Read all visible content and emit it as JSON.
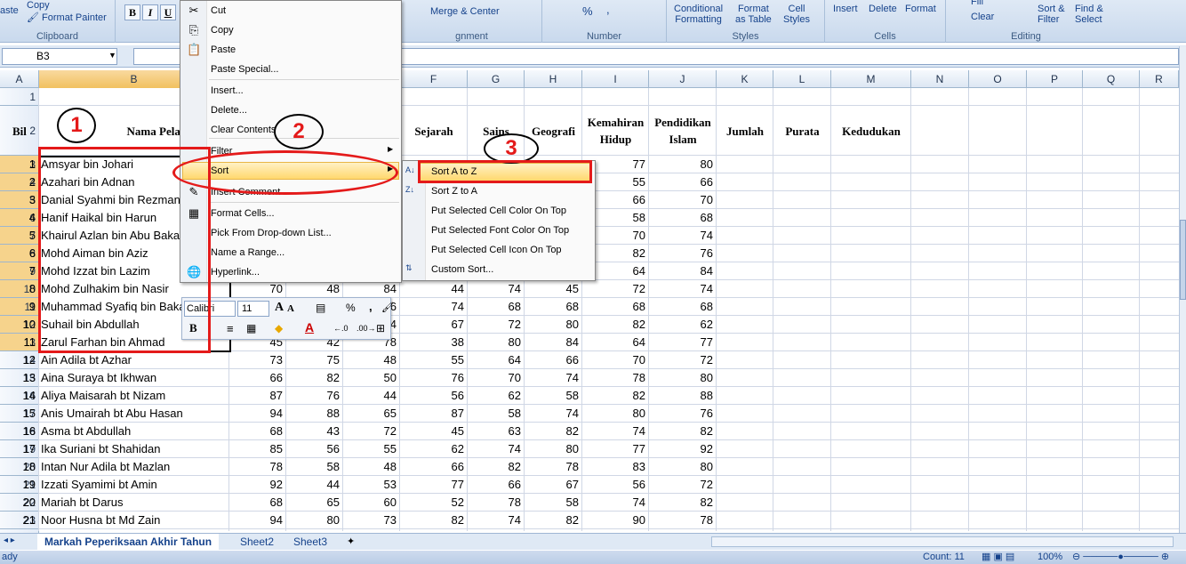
{
  "ribbon": {
    "clipboard": {
      "paste": "aste",
      "copy": "Copy",
      "format_painter": "Format Painter",
      "label": "Clipboard"
    },
    "font": {
      "bold": "B",
      "italic": "I",
      "underline": "U"
    },
    "alignment": {
      "merge": "Merge & Center",
      "label": "gnment"
    },
    "number": {
      "percent": "%",
      "comma": ",",
      "label": "Number"
    },
    "styles": {
      "conditional": "Conditional\nFormatting",
      "format_table": "Format\nas Table",
      "cell_styles": "Cell\nStyles",
      "label": "Styles"
    },
    "cells": {
      "insert": "Insert",
      "delete": "Delete",
      "format": "Format",
      "label": "Cells"
    },
    "editing": {
      "fill": "Fill",
      "clear": "Clear",
      "sort_filter": "Sort &\nFilter",
      "find_select": "Find &\nSelect",
      "label": "Editing"
    }
  },
  "formula_bar": {
    "name_box": "B3",
    "formula": ""
  },
  "columns": [
    "A",
    "B",
    "C",
    "D",
    "E",
    "F",
    "G",
    "H",
    "I",
    "J",
    "K",
    "L",
    "M",
    "N",
    "O",
    "P",
    "Q",
    "R"
  ],
  "headers": {
    "bil": "Bil",
    "nama": "Nama Pelajar",
    "bm": "k",
    "sejarah": "Sejarah",
    "sains": "Sains",
    "geografi": "Geografi",
    "kemahiran": "Kemahiran\nHidup",
    "pendidikan": "Pendidikan\nIslam",
    "jumlah": "Jumlah",
    "purata": "Purata",
    "kedudukan": "Kedudukan"
  },
  "rows": [
    {
      "bil": "1",
      "name": "Amsyar bin Johari",
      "c": "",
      "d": "",
      "e": "",
      "f": "",
      "g": "",
      "h": "",
      "i": "77",
      "j": "80"
    },
    {
      "bil": "2",
      "name": "Azahari bin Adnan",
      "c": "",
      "d": "",
      "e": "",
      "f": "",
      "g": "",
      "h": "",
      "i": "55",
      "j": "66"
    },
    {
      "bil": "3",
      "name": "Danial Syahmi bin Rezman",
      "c": "",
      "d": "",
      "e": "",
      "f": "",
      "g": "",
      "h": "",
      "i": "66",
      "j": "70"
    },
    {
      "bil": "4",
      "name": "Hanif Haikal bin Harun",
      "c": "",
      "d": "",
      "e": "",
      "f": "",
      "g": "",
      "h": "",
      "i": "58",
      "j": "68"
    },
    {
      "bil": "5",
      "name": "Khairul Azlan bin Abu Bakar",
      "c": "",
      "d": "",
      "e": "",
      "f": "",
      "g": "",
      "h": "",
      "i": "70",
      "j": "74"
    },
    {
      "bil": "6",
      "name": "Mohd Aiman bin Aziz",
      "c": "",
      "d": "",
      "e": "",
      "f": "",
      "g": "",
      "h": "",
      "i": "82",
      "j": "76"
    },
    {
      "bil": "7",
      "name": "Mohd Izzat bin Lazim",
      "c": "",
      "d": "",
      "e": "",
      "f": "",
      "g": "",
      "h": "",
      "i": "64",
      "j": "84"
    },
    {
      "bil": "8",
      "name": "Mohd Zulhakim bin Nasir",
      "c": "70",
      "d": "48",
      "e": "84",
      "f": "44",
      "g": "74",
      "h": "45",
      "i": "72",
      "j": "74"
    },
    {
      "bil": "9",
      "name": "Muhammad Syafiq bin Bakar",
      "c": "",
      "d": "",
      "e": "6",
      "f": "74",
      "g": "68",
      "h": "68",
      "i": "68",
      "j": "68"
    },
    {
      "bil": "10",
      "name": "Suhail bin Abdullah",
      "c": "",
      "d": "",
      "e": "4",
      "f": "67",
      "g": "72",
      "h": "80",
      "i": "82",
      "j": "62"
    },
    {
      "bil": "11",
      "name": "Zarul Farhan bin Ahmad",
      "c": "45",
      "d": "42",
      "e": "78",
      "f": "38",
      "g": "80",
      "h": "84",
      "i": "64",
      "j": "77"
    },
    {
      "bil": "12",
      "name": "Ain Adila bt Azhar",
      "c": "73",
      "d": "75",
      "e": "48",
      "f": "55",
      "g": "64",
      "h": "66",
      "i": "70",
      "j": "72"
    },
    {
      "bil": "13",
      "name": "Aina Suraya bt Ikhwan",
      "c": "66",
      "d": "82",
      "e": "50",
      "f": "76",
      "g": "70",
      "h": "74",
      "i": "78",
      "j": "80"
    },
    {
      "bil": "14",
      "name": "Aliya Maisarah bt Nizam",
      "c": "87",
      "d": "76",
      "e": "44",
      "f": "56",
      "g": "62",
      "h": "58",
      "i": "82",
      "j": "88"
    },
    {
      "bil": "15",
      "name": "Anis Umairah bt Abu Hasan",
      "c": "94",
      "d": "88",
      "e": "65",
      "f": "87",
      "g": "58",
      "h": "74",
      "i": "80",
      "j": "76"
    },
    {
      "bil": "16",
      "name": "Asma bt Abdullah",
      "c": "68",
      "d": "43",
      "e": "72",
      "f": "45",
      "g": "63",
      "h": "82",
      "i": "74",
      "j": "82"
    },
    {
      "bil": "17",
      "name": "Ika Suriani bt Shahidan",
      "c": "85",
      "d": "56",
      "e": "55",
      "f": "62",
      "g": "74",
      "h": "80",
      "i": "77",
      "j": "92"
    },
    {
      "bil": "18",
      "name": "Intan Nur Adila bt Mazlan",
      "c": "78",
      "d": "58",
      "e": "48",
      "f": "66",
      "g": "82",
      "h": "78",
      "i": "83",
      "j": "80"
    },
    {
      "bil": "19",
      "name": "Izzati Syamimi bt Amin",
      "c": "92",
      "d": "44",
      "e": "53",
      "f": "77",
      "g": "66",
      "h": "67",
      "i": "56",
      "j": "72"
    },
    {
      "bil": "20",
      "name": "Mariah bt Darus",
      "c": "68",
      "d": "65",
      "e": "60",
      "f": "52",
      "g": "78",
      "h": "58",
      "i": "74",
      "j": "82"
    },
    {
      "bil": "21",
      "name": "Noor Husna bt Md Zain",
      "c": "94",
      "d": "80",
      "e": "73",
      "f": "82",
      "g": "74",
      "h": "82",
      "i": "90",
      "j": "78"
    }
  ],
  "row_numbers": [
    "1",
    "2",
    "3",
    "4",
    "5",
    "6",
    "7",
    "8",
    "9",
    "10",
    "11",
    "12",
    "13",
    "14",
    "15",
    "16",
    "17",
    "18",
    "19",
    "20",
    "21",
    "22",
    "23",
    "24",
    "25"
  ],
  "context_menu": {
    "items": [
      "Cut",
      "Copy",
      "Paste",
      "Paste Special...",
      "Insert...",
      "Delete...",
      "Clear Contents",
      "Filter",
      "Sort",
      "Insert Comment",
      "Format Cells...",
      "Pick From Drop-down List...",
      "Name a Range...",
      "Hyperlink..."
    ]
  },
  "sort_submenu": {
    "items": [
      "Sort A to Z",
      "Sort Z to A",
      "Put Selected Cell Color On Top",
      "Put Selected Font Color On Top",
      "Put Selected Cell Icon On Top",
      "Custom Sort..."
    ]
  },
  "mini_toolbar": {
    "font": "Calibri",
    "size": "11",
    "bold": "B",
    "percent": "%",
    "comma": ","
  },
  "annotations": {
    "n1": "1",
    "n2": "2",
    "n3": "3"
  },
  "sheet_tabs": [
    "Markah Peperiksaan Akhir Tahun",
    "Sheet2",
    "Sheet3"
  ],
  "status": {
    "ready": "ady",
    "count": "Count: 11",
    "zoom": "100%"
  },
  "colors": {
    "highlight_red": "#e41a1a",
    "selection_orange": "#f6d38c",
    "ribbon_blue": "#dfe9f5"
  }
}
